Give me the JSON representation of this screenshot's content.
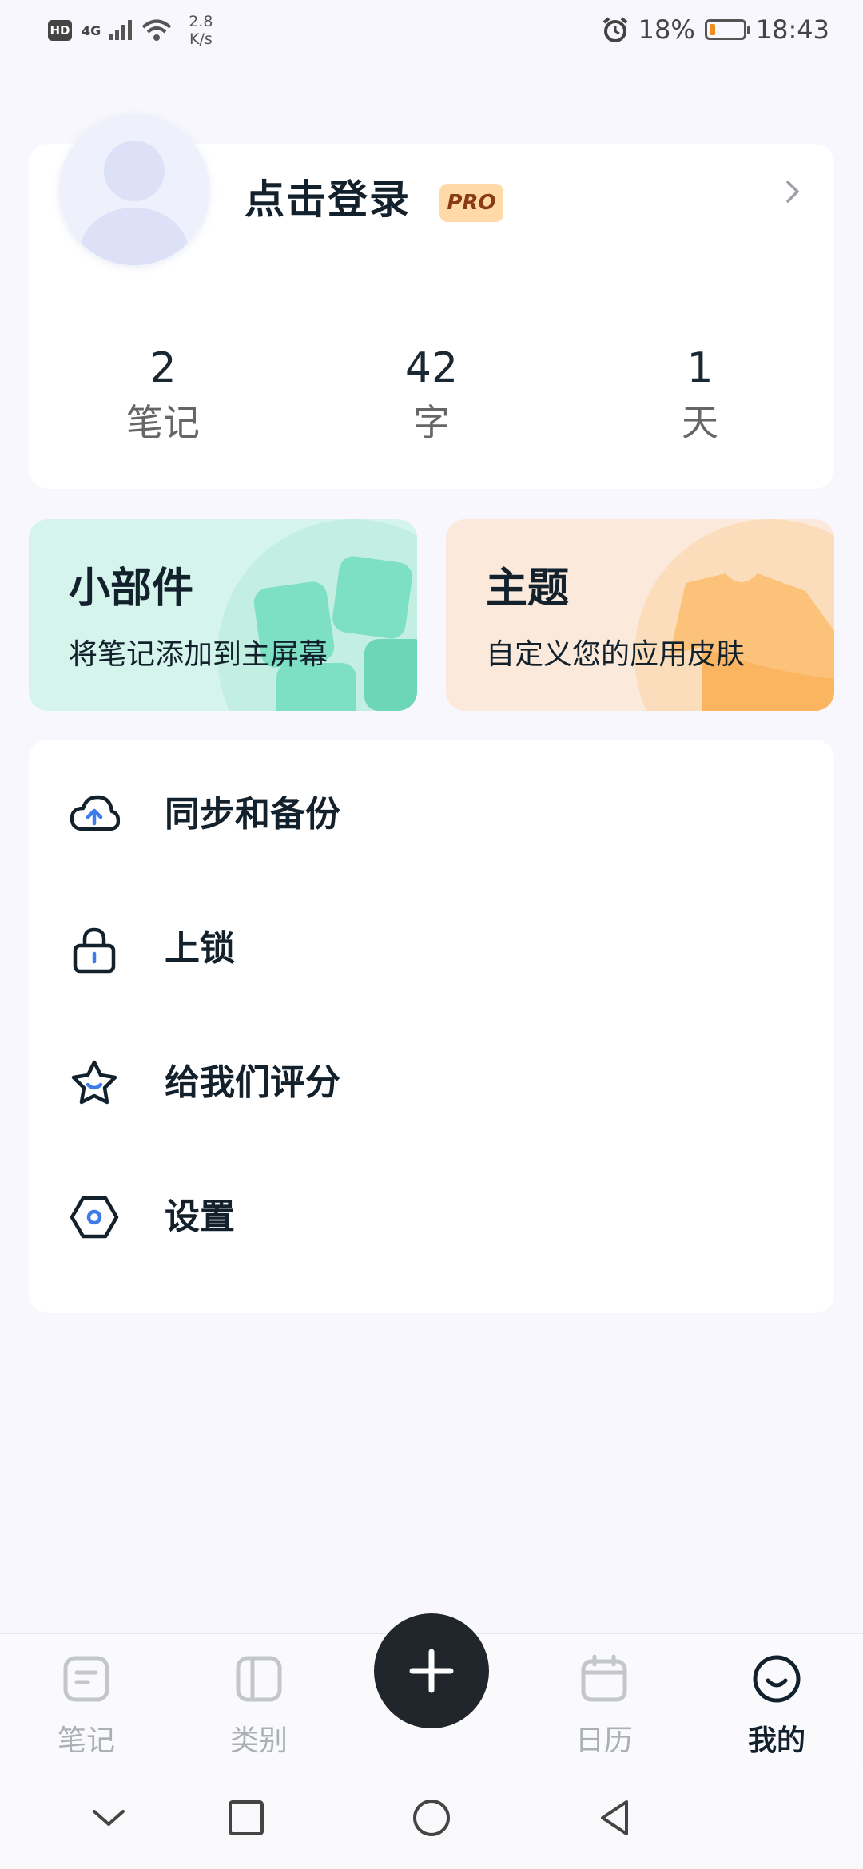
{
  "status_bar": {
    "hd": "HD",
    "network": "4G",
    "speed_value": "2.8",
    "speed_unit": "K/s",
    "battery": "18%",
    "battery_level": 0.18,
    "time": "18:43"
  },
  "profile": {
    "login_label": "点击登录",
    "pro_badge": "PRO",
    "stats": [
      {
        "value": "2",
        "label": "笔记"
      },
      {
        "value": "42",
        "label": "字"
      },
      {
        "value": "1",
        "label": "天"
      }
    ]
  },
  "tiles": {
    "widget": {
      "title": "小部件",
      "subtitle": "将笔记添加到主屏幕"
    },
    "theme": {
      "title": "主题",
      "subtitle": "自定义您的应用皮肤"
    }
  },
  "menu": [
    {
      "label": "同步和备份",
      "icon": "cloud-upload-icon"
    },
    {
      "label": "上锁",
      "icon": "lock-icon"
    },
    {
      "label": "给我们评分",
      "icon": "star-icon"
    },
    {
      "label": "设置",
      "icon": "settings-hexagon-icon"
    }
  ],
  "tabbar": {
    "notes": "笔记",
    "categories": "类别",
    "calendar": "日历",
    "mine": "我的",
    "active": "mine"
  },
  "colors": {
    "accent": "#20262c",
    "pro_bg": "#ffd9a8",
    "widget_bg": "#d5f5ec",
    "theme_bg": "#fbeadb",
    "icon_accent": "#3d7be8"
  }
}
